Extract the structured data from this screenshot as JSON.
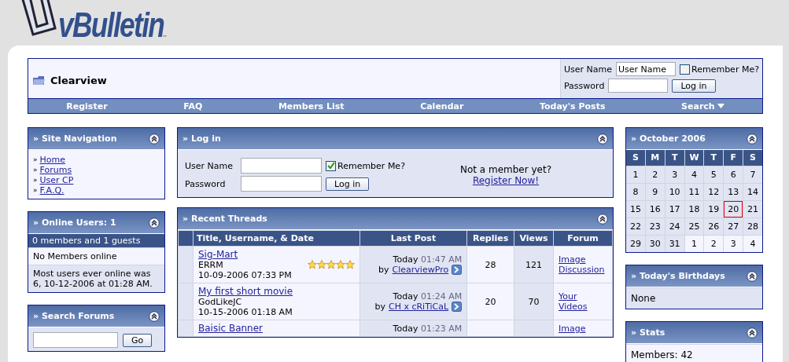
{
  "logo": {
    "text": "vBulletin",
    "tm": "™"
  },
  "header": {
    "title": "Clearview",
    "login": {
      "username_label": "User Name",
      "username_value": "User Name",
      "password_label": "Password",
      "remember_label": "Remember Me?",
      "remember_checked": false,
      "button": "Log in"
    }
  },
  "navbar": [
    {
      "label": "Register",
      "dropdown": false
    },
    {
      "label": "FAQ",
      "dropdown": false
    },
    {
      "label": "Members List",
      "dropdown": false
    },
    {
      "label": "Calendar",
      "dropdown": false
    },
    {
      "label": "Today's Posts",
      "dropdown": false
    },
    {
      "label": "Search",
      "dropdown": true
    }
  ],
  "site_navigation": {
    "title": "» Site Navigation",
    "links": [
      {
        "bullet": "»",
        "label": "Home"
      },
      {
        "bullet": "»",
        "label": "Forums"
      },
      {
        "bullet": "»",
        "label": "User CP"
      },
      {
        "bullet": "»",
        "label": "F.A.Q."
      }
    ]
  },
  "online_users": {
    "title": "» Online Users: 1",
    "summary": "0 members and 1 guests",
    "members": "No Members online",
    "record": "Most users ever online was 6, 10-12-2006 at 01:28 AM."
  },
  "search_forums": {
    "title": "» Search Forums",
    "button": "Go"
  },
  "login_block": {
    "title": "» Log in",
    "username_label": "User Name",
    "password_label": "Password",
    "remember_label": "Remember Me?",
    "remember_checked": true,
    "button": "Log in",
    "not_member": "Not a member yet?",
    "register_link": "Register Now!"
  },
  "recent_threads": {
    "title": "» Recent Threads",
    "columns": [
      "Title, Username, & Date",
      "Last Post",
      "Replies",
      "Views",
      "Forum"
    ],
    "rows": [
      {
        "title": "Sig-Mart",
        "user": "ERRM",
        "date": "10-09-2006 07:33 PM",
        "stars": 5,
        "last_day": "Today",
        "last_time": "01:47 AM",
        "by": "by",
        "last_user": "ClearviewPro",
        "replies": "28",
        "views": "121",
        "forum": "Image Discussion"
      },
      {
        "title": "My first short movie",
        "user": "GodLikeJC",
        "date": "10-15-2006 01:18 AM",
        "last_day": "Today",
        "last_time": "01:24 AM",
        "by": "by",
        "last_user": "CH x cRiTiCaL",
        "replies": "20",
        "views": "70",
        "forum": "Your Videos"
      },
      {
        "title": "Baisic Banner",
        "last_day": "Today",
        "last_time": "01:23 AM",
        "forum": "Image"
      }
    ]
  },
  "calendar": {
    "title": "» October 2006",
    "weekdays": [
      "S",
      "M",
      "T",
      "W",
      "T",
      "F",
      "S"
    ],
    "days": [
      {
        "day": "1",
        "other_month": false,
        "today": false
      },
      {
        "day": "2",
        "other_month": false,
        "today": false
      },
      {
        "day": "3",
        "other_month": false,
        "today": false
      },
      {
        "day": "4",
        "other_month": false,
        "today": false
      },
      {
        "day": "5",
        "other_month": false,
        "today": false
      },
      {
        "day": "6",
        "other_month": false,
        "today": false
      },
      {
        "day": "7",
        "other_month": false,
        "today": false
      },
      {
        "day": "8",
        "other_month": false,
        "today": false
      },
      {
        "day": "9",
        "other_month": false,
        "today": false
      },
      {
        "day": "10",
        "other_month": false,
        "today": false
      },
      {
        "day": "11",
        "other_month": false,
        "today": false
      },
      {
        "day": "12",
        "other_month": false,
        "today": false
      },
      {
        "day": "13",
        "other_month": false,
        "today": false
      },
      {
        "day": "14",
        "other_month": false,
        "today": false
      },
      {
        "day": "15",
        "other_month": false,
        "today": false
      },
      {
        "day": "16",
        "other_month": false,
        "today": false
      },
      {
        "day": "17",
        "other_month": false,
        "today": false
      },
      {
        "day": "18",
        "other_month": false,
        "today": false
      },
      {
        "day": "19",
        "other_month": false,
        "today": false
      },
      {
        "day": "20",
        "other_month": false,
        "today": true
      },
      {
        "day": "21",
        "other_month": false,
        "today": false
      },
      {
        "day": "22",
        "other_month": false,
        "today": false
      },
      {
        "day": "23",
        "other_month": false,
        "today": false
      },
      {
        "day": "24",
        "other_month": false,
        "today": false
      },
      {
        "day": "25",
        "other_month": false,
        "today": false
      },
      {
        "day": "26",
        "other_month": false,
        "today": false
      },
      {
        "day": "27",
        "other_month": false,
        "today": false
      },
      {
        "day": "28",
        "other_month": false,
        "today": false
      },
      {
        "day": "29",
        "other_month": false,
        "today": false
      },
      {
        "day": "30",
        "other_month": false,
        "today": false
      },
      {
        "day": "31",
        "other_month": false,
        "today": false
      },
      {
        "day": "1",
        "other_month": true,
        "today": false
      },
      {
        "day": "2",
        "other_month": true,
        "today": false
      },
      {
        "day": "3",
        "other_month": true,
        "today": false
      },
      {
        "day": "4",
        "other_month": true,
        "today": false
      }
    ]
  },
  "birthdays": {
    "title": "» Today's Birthdays",
    "text": "None"
  },
  "stats": {
    "title": "» Stats",
    "members": "Members: 42"
  }
}
